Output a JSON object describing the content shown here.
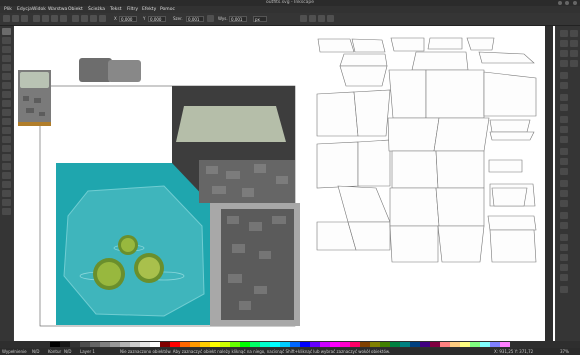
{
  "window": {
    "title": "outfits.svg - Inkscape"
  },
  "menu": [
    "Plik",
    "Edycja",
    "Widok",
    "Warstwa",
    "Obiekt",
    "Ścieżka",
    "Tekst",
    "Filtry",
    "Efekty",
    "Pomoc"
  ],
  "controls": {
    "x_label": "X",
    "x_value": "0,000",
    "y_label": "Y",
    "y_value": "0,000",
    "w_label": "Szer.",
    "w_value": "0,001",
    "h_label": "Wys.",
    "h_value": "0,001",
    "unit": "px"
  },
  "palette": [
    "#000000",
    "#1a1a1a",
    "#333333",
    "#4d4d4d",
    "#666666",
    "#808080",
    "#999999",
    "#b3b3b3",
    "#cccccc",
    "#e6e6e6",
    "#ffffff",
    "#800000",
    "#ff0000",
    "#ff6600",
    "#ff9900",
    "#ffcc00",
    "#ffff00",
    "#ccff00",
    "#66ff00",
    "#00ff00",
    "#00ff66",
    "#00ffcc",
    "#00ffff",
    "#00ccff",
    "#0066ff",
    "#0000ff",
    "#6600ff",
    "#cc00ff",
    "#ff00ff",
    "#ff00cc",
    "#ff0066",
    "#804000",
    "#808000",
    "#408000",
    "#008040",
    "#008080",
    "#004080",
    "#400080",
    "#800040",
    "#ff8080",
    "#ffcc80",
    "#ffff80",
    "#80ff80",
    "#80ffff",
    "#8080ff",
    "#ff80ff"
  ],
  "status": {
    "fill_label": "Wypełnienie",
    "stroke_label": "Kontur",
    "fill_value": "N/D",
    "stroke_value": "N/D",
    "layer": "Layer 1",
    "message": "Nie zaznaczono obiektów. Aby zaznaczyć obiekt należy kliknąć na niego, nacisnąć Shift+kliknąć lub wybrać zaznaczyć wokół obiektów.",
    "coords": "X: 931,25  Y: 371,72",
    "zoom": "37%"
  },
  "colors": {
    "teal": "#1aa0a8",
    "gray_dark": "#5a5a5a",
    "gray_light": "#a8a8a8"
  }
}
